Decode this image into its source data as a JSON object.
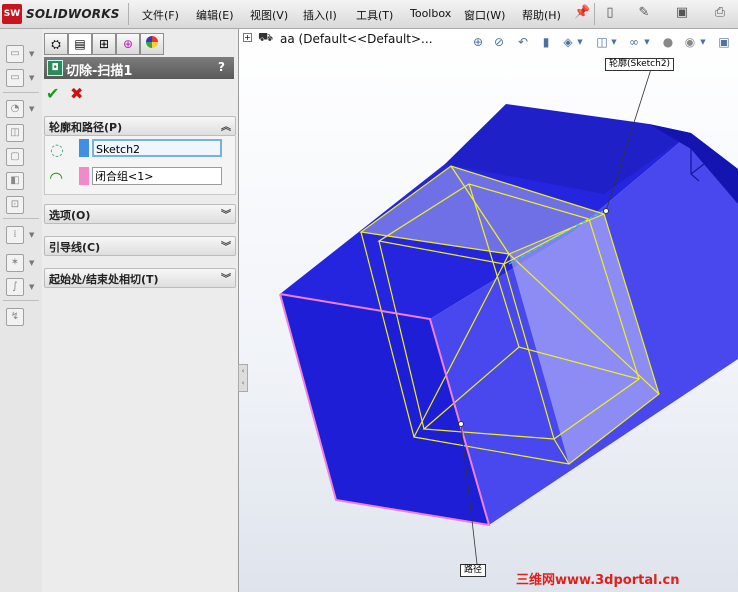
{
  "app": {
    "logo_badge": "SW",
    "logo_text": "SOLIDWORKS"
  },
  "menu": [
    "文件(F)",
    "编辑(E)",
    "视图(V)",
    "插入(I)",
    "工具(T)",
    "Toolbox",
    "窗口(W)",
    "帮助(H)"
  ],
  "toolbar_icons": [
    "pin-icon",
    "new-document-icon",
    "open-icon",
    "options-icon",
    "print-icon"
  ],
  "property_manager": {
    "tabs": [
      "feature-manager-tab",
      "property-manager-tab",
      "configuration-manager-tab",
      "dimxpert-tab",
      "appearance-tab"
    ],
    "title": "切除-扫描1",
    "help": "?",
    "sections": {
      "profile_path": {
        "title": "轮廓和路径(P)",
        "profile_value": "Sketch2",
        "path_value": "闭合组<1>",
        "profile_color": "#3f8fe6",
        "path_color": "#f08ac8"
      },
      "options": {
        "title": "选项(O)"
      },
      "guide_curves": {
        "title": "引导线(C)"
      },
      "tangency": {
        "title": "起始处/结束处相切(T)"
      }
    }
  },
  "graphics": {
    "tree_label": "aa  (Default<<Default>...",
    "profile_callout": "轮廓(Sketch2)",
    "path_callout": "路径",
    "part_color": "#1a1ad9",
    "profile_edge_color": "#f0f020",
    "path_edge_color": "#f080e0"
  },
  "watermark": "三维网www.3dportal.cn"
}
